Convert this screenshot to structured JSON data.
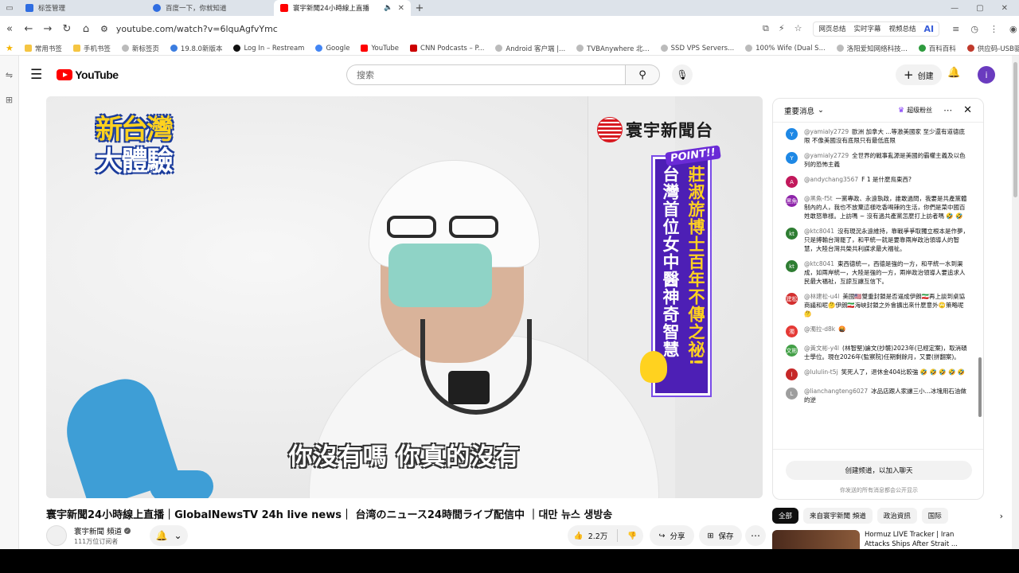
{
  "browser": {
    "tabs": [
      {
        "label": "标签管理",
        "color": "#2f6de1"
      },
      {
        "label": "百度一下，你就知道",
        "color": "#2f6de1"
      },
      {
        "label": "寰宇新聞24小時線上直播",
        "color": "#ff0000"
      }
    ],
    "url": "youtube.com/watch?v=6lquAgfvYmc",
    "extensions": [
      "网页总结",
      "实时字幕",
      "视频总结"
    ],
    "ai_label": "AI",
    "bookmarks": [
      "常用书签",
      "手机书签",
      "新标签页",
      "19.8.0新版本",
      "Log In – Restream",
      "Google",
      "YouTube",
      "CNN Podcasts – P...",
      "Android 客户端 |...",
      "TVBAnywhere 北...",
      "SSD VPS Servers...",
      "100% Wife (Dual S...",
      "洛阳爱知网络科技...",
      "百科百科",
      "供应码-USB驱动..."
    ]
  },
  "youtube": {
    "logo_text": "YouTube",
    "search_placeholder": "搜索",
    "create_label": "创建",
    "avatar_letter": "i"
  },
  "video": {
    "show_logo_line1": "新台灣",
    "show_logo_line2": "大體驗",
    "brand": "寰宇新聞台",
    "point_label": "POINT!!",
    "banner_col1": "台灣首位女中醫神奇智慧",
    "banner_col2": "莊淑旂博士百年不傳之祕!",
    "subtitle": "你沒有嗎  你真的沒有",
    "title": "寰宇新聞24小時線上直播｜GlobalNewsTV 24h live news｜ 台湾のニュース24時間ライブ配信中 ｜대만 뉴스 생방송",
    "channel_name": "寰宇新聞 頻道",
    "subscribers": "111万位订阅者",
    "likes": "2.2万",
    "share_label": "分享",
    "save_label": "保存"
  },
  "chat": {
    "mode_label": "重要消息",
    "superfan_label": "超级粉丝",
    "messages": [
      {
        "author": "@yamialy2729",
        "text": "歐洲 加拿大 ...等激美國家 至少還有道德底限 不像美國沒有底限只有最低底限",
        "avatar": "Y",
        "color": "#1e88e5"
      },
      {
        "author": "@yamialy2729",
        "text": "全世界的戰事亂源是美國的霸權主義及以色列的恐怖主義",
        "avatar": "Y",
        "color": "#1e88e5"
      },
      {
        "author": "@andychang3567",
        "text": "F 1 是什麼鳥東西?",
        "avatar": "A",
        "color": "#c2185b"
      },
      {
        "author": "@黑魚-f5t",
        "text": "一黨專政、永遠執政，誰敢過問，我要是共產黨體制內的人，我也不放棄這樣吃香喝辣的生活，你們是菜中國百姓敢怒靠樣。上訪嗎 ~ 沒有過共產黨怎麼打上訪者嗎 🤣 🤣",
        "avatar": "黑魚",
        "color": "#8e24aa"
      },
      {
        "author": "@ktc8041",
        "text": "沒有現況永遠維持，靠戰爭爭取獨立根本是作夢，只是搏輸台灣罷了，和平統一就是要靠兩岸政治領導人的智慧，大陸台灣共榮共利謀求最大福祉。",
        "avatar": "kt",
        "color": "#2e7d32"
      },
      {
        "author": "@ktc8041",
        "text": "東西德統一，西德是強的一方，和平統一水到渠成，如兩岸統一，大陸是強的一方，兩岸政治領導人要追求人民最大福祉，互諒互讓互信下。",
        "avatar": "kt",
        "color": "#2e7d32"
      },
      {
        "author": "@林建松-u4l",
        "text": "美國🇺🇸雙重封鎖是否逼成伊朗🇮🇷再上談到桌協商議和呢🤔伊朗🇮🇷海峽封鎖之外會擴出來什麼意外🙄策略呢🤔",
        "avatar": "建松",
        "color": "#d32f2f"
      },
      {
        "author": "@濁拉-d8k",
        "text": "🤬",
        "avatar": "濁",
        "color": "#e53935"
      },
      {
        "author": "@黃文彬-y4l",
        "text": "(林智堅)論文(抄襲)2023年(已經定案)，取消碩士學位。現在2026年(監察院)任期剩餘月，又要(拼翻案)。",
        "avatar": "文彬",
        "color": "#43a047"
      },
      {
        "author": "@lululin-t5j",
        "text": "笑死人了，退休金404比較強 🤣 🤣 🤣 🤣 🤣",
        "avatar": "l",
        "color": "#c62828"
      },
      {
        "author": "@lianchangteng6027",
        "text": "冰品店跟人家讓三小...冰塊用石油做的逆",
        "avatar": "L",
        "color": "#9e9e9e"
      }
    ],
    "join_label": "创建频道，以加入聊天",
    "foot_note": "你发送的所有消息都会公开显示"
  },
  "related": {
    "chips": [
      "全部",
      "来自寰宇新聞 頻道",
      "政治資訊",
      "国际"
    ],
    "first_title": "Hormuz LIVE Tracker | Iran Attacks Ships After Strait ..."
  }
}
